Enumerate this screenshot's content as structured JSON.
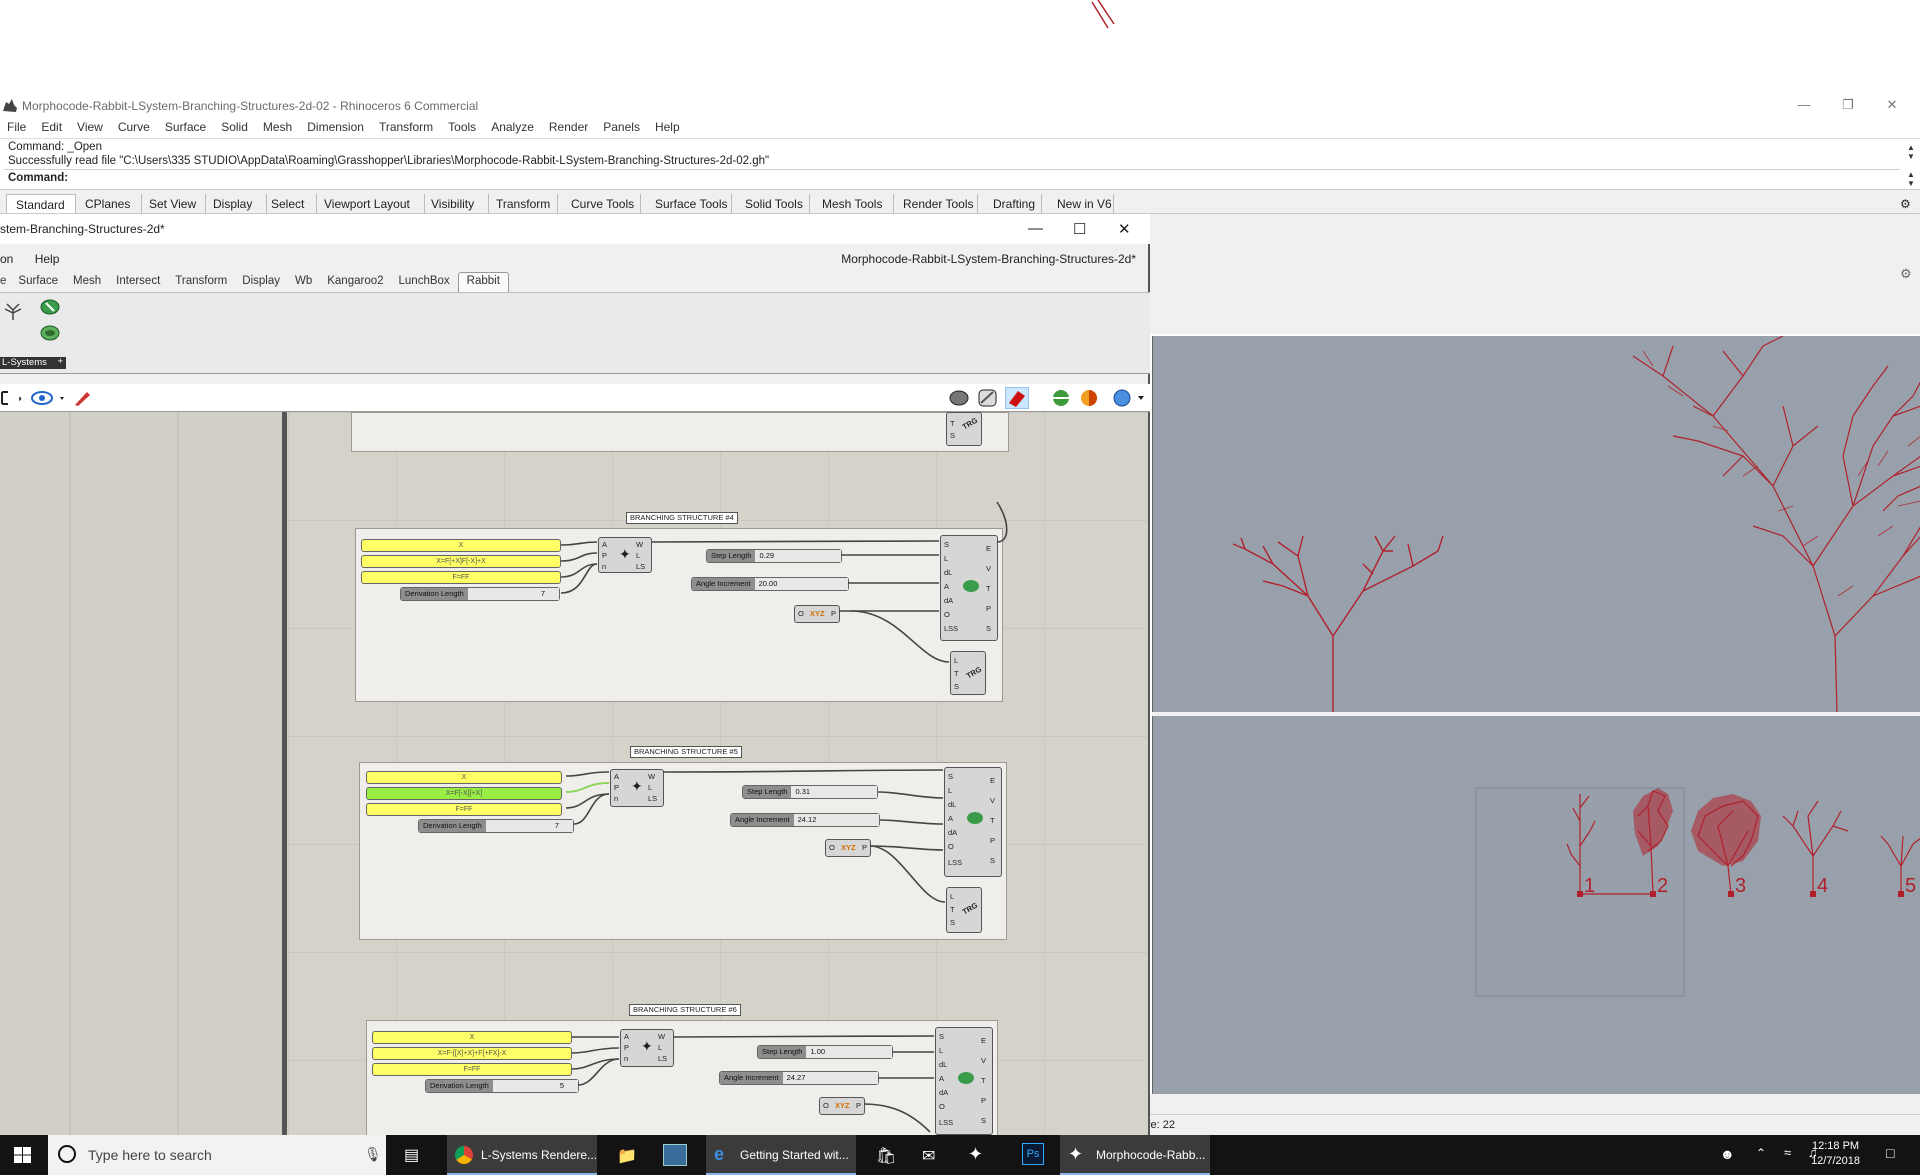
{
  "rhino": {
    "title": "Morphocode-Rabbit-LSystem-Branching-Structures-2d-02 - Rhinoceros 6 Commercial",
    "menu": [
      "File",
      "Edit",
      "View",
      "Curve",
      "Surface",
      "Solid",
      "Mesh",
      "Dimension",
      "Transform",
      "Tools",
      "Analyze",
      "Render",
      "Panels",
      "Help"
    ],
    "command_lines": [
      "Command: _Open",
      "Successfully read file \"C:\\Users\\335 STUDIO\\AppData\\Roaming\\Grasshopper\\Libraries\\Morphocode-Rabbit-LSystem-Branching-Structures-2d-02.gh\""
    ],
    "command_prompt": "Command:",
    "toolbar_tabs": [
      "Standard",
      "CPlanes",
      "Set View",
      "Display",
      "Select",
      "Viewport Layout",
      "Visibility",
      "Transform",
      "Curve Tools",
      "Surface Tools",
      "Solid Tools",
      "Mesh Tools",
      "Render Tools",
      "Drafting",
      "New in V6"
    ],
    "active_tab": "Standard",
    "status": "ve: 22",
    "point_labels": [
      "1",
      "2",
      "3",
      "4",
      "5"
    ]
  },
  "grasshopper": {
    "title": "stem-Branching-Structures-2d*",
    "menu": [
      "on",
      "Help"
    ],
    "doc_name": "Morphocode-Rabbit-LSystem-Branching-Structures-2d*",
    "tabs": [
      "e",
      "Surface",
      "Mesh",
      "Intersect",
      "Transform",
      "Display",
      "Wb",
      "Kangaroo2",
      "LunchBox",
      "Rabbit"
    ],
    "active_tab": "Rabbit",
    "ribbon_group": "L-Systems",
    "groups": [
      {
        "label": "BRANCHING STRUCTURE #4",
        "panels": [
          "X",
          "X=F[+X]F[-X]+X",
          "F=FF"
        ],
        "derivation": {
          "name": "Derivation Length",
          "value": "7"
        },
        "step": {
          "name": "Step Length",
          "value": "0.29"
        },
        "angle": {
          "name": "Angle Increment",
          "value": "20.00"
        }
      },
      {
        "label": "BRANCHING STRUCTURE #5",
        "panels": [
          "X",
          "X=F[-X][+X]",
          "F=FF"
        ],
        "derivation": {
          "name": "Derivation Length",
          "value": "7"
        },
        "step": {
          "name": "Step Length",
          "value": "0.31"
        },
        "angle": {
          "name": "Angle Increment",
          "value": "24.12"
        }
      },
      {
        "label": "BRANCHING STRUCTURE #6",
        "panels": [
          "X",
          "X=F-[[X]+X]+F[+FX]-X",
          "F=FF"
        ],
        "derivation": {
          "name": "Derivation Length",
          "value": "5"
        },
        "step": {
          "name": "Step Length",
          "value": "1.00"
        },
        "angle": {
          "name": "Angle Increment",
          "value": "24.27"
        }
      }
    ],
    "lsys_inputs": [
      "A",
      "P",
      "n"
    ],
    "lsys_outputs": [
      "W",
      "L",
      "LS"
    ],
    "turtle_inputs": [
      "S",
      "L",
      "dL",
      "A",
      "dA",
      "O",
      "LSS"
    ],
    "turtle_outputs": [
      "E",
      "V",
      "T",
      "P",
      "S"
    ],
    "trg_inputs": [
      "L",
      "T",
      "S"
    ],
    "trg_label": "TRG",
    "xyz_in": "O",
    "xyz_out": "P",
    "xyz_label": "XYZ"
  },
  "taskbar": {
    "search_placeholder": "Type here to search",
    "items": [
      "L-Systems Rendere...",
      "Getting Started wit...",
      "Morphocode-Rabb..."
    ],
    "time": "12:18 PM",
    "date": "12/7/2018"
  },
  "colors": {
    "curve": "#b0212b",
    "panel": "#ffff66",
    "panel_green": "#99ee44",
    "viewport": "#98a1ab"
  }
}
